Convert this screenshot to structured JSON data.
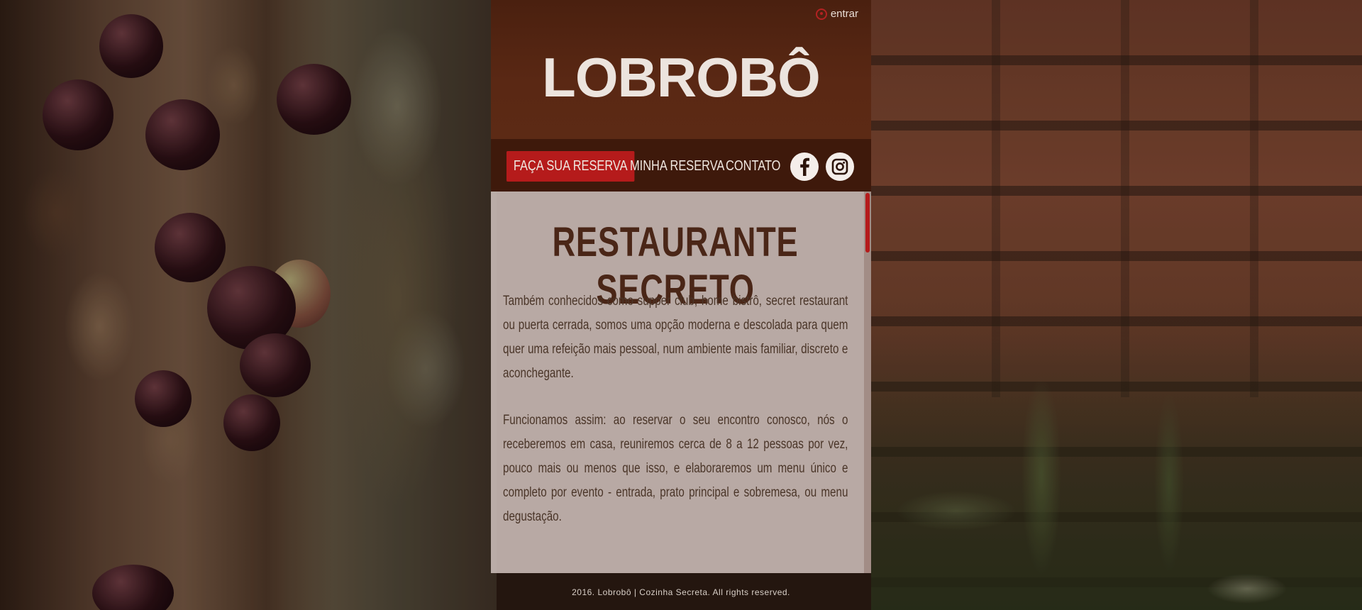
{
  "header": {
    "login_label": "entrar",
    "logo_text": "LOBROBÔ"
  },
  "nav": {
    "items": [
      {
        "label": "FAÇA SUA RESERVA",
        "active": true
      },
      {
        "label": "MINHA RESERVA",
        "active": false
      },
      {
        "label": "CONTATO",
        "active": false
      }
    ],
    "social": [
      {
        "icon": "facebook-icon"
      },
      {
        "icon": "instagram-icon"
      }
    ]
  },
  "content": {
    "title": "RESTAURANTE SECRETO",
    "paragraphs": [
      "Também conhecidos como supper club, home bistrô, secret restaurant ou puerta cerrada, somos uma opção moderna e descolada para quem quer uma refeição mais pessoal, num ambiente mais familiar, discreto e aconchegante.",
      "Funcionamos assim: ao reservar o seu encontro conosco, nós o receberemos em casa, reuniremos cerca de 8 a 12 pessoas por vez, pouco mais ou menos que isso, e elaboraremos um menu único e completo por evento - entrada, prato principal e sobremesa, ou menu degustação."
    ]
  },
  "footer": {
    "text": "2016. Lobrobô | Cozinha Secreta. All rights reserved."
  },
  "colors": {
    "accent_red": "#b51b1b",
    "header_brown": "#5a2814",
    "nav_brown": "#3e190b",
    "title_brown": "#4a2617"
  }
}
